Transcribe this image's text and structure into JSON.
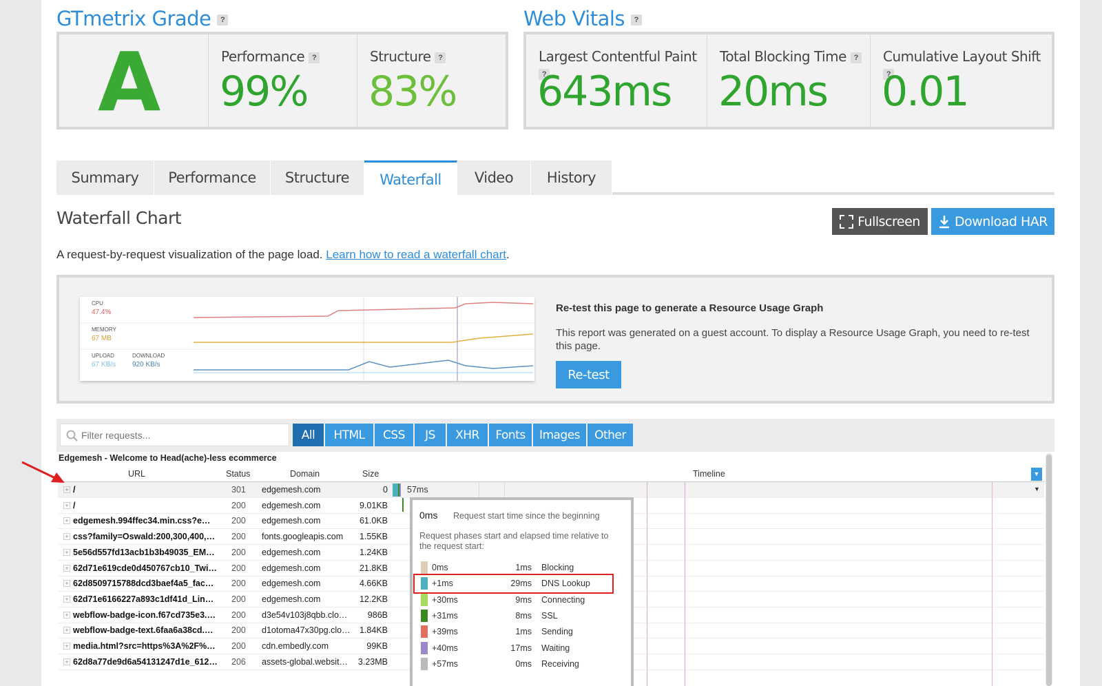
{
  "grade": {
    "title": "GTmetrix Grade",
    "help": "?",
    "letter": "A",
    "performance": {
      "label": "Performance",
      "value": "99%"
    },
    "structure": {
      "label": "Structure",
      "value": "83%"
    }
  },
  "vitals": {
    "title": "Web Vitals",
    "lcp": {
      "label": "Largest Contentful Paint",
      "value": "643ms"
    },
    "tbt": {
      "label": "Total Blocking Time",
      "value": "20ms"
    },
    "cls": {
      "label": "Cumulative Layout Shift",
      "value": "0.01"
    }
  },
  "tabs": [
    "Summary",
    "Performance",
    "Structure",
    "Waterfall",
    "Video",
    "History"
  ],
  "waterfall": {
    "title": "Waterfall Chart",
    "fullscreen": "Fullscreen",
    "download": "Download HAR",
    "desc": "A request-by-request visualization of the page load. ",
    "link": "Learn how to read a waterfall chart",
    "period": "."
  },
  "usage": {
    "cpu_label": "CPU",
    "cpu_val": "47.4%",
    "mem_label": "MEMORY",
    "mem_val": "67 MB",
    "up_label": "UPLOAD",
    "up_val": "67 KB/s",
    "down_label": "DOWNLOAD",
    "down_val": "920 KB/s",
    "heading": "Re-test this page to generate a Resource Usage Graph",
    "text": "This report was generated on a guest account. To display a Resource Usage Graph, you need to re-test this page.",
    "retest": "Re-test",
    "colors": {
      "cpu": "#e08080",
      "memory": "#e0b040",
      "upload": "#80c0e8",
      "download": "#5a90c0"
    }
  },
  "filter": {
    "placeholder": "Filter requests...",
    "tabs": [
      "All",
      "HTML",
      "CSS",
      "JS",
      "XHR",
      "Fonts",
      "Images",
      "Other"
    ]
  },
  "table": {
    "page_title": "Edgemesh - Welcome to Head(ache)-less ecommerce",
    "headers": {
      "url": "URL",
      "status": "Status",
      "domain": "Domain",
      "size": "Size",
      "timeline": "Timeline"
    },
    "rows": [
      {
        "url": "/",
        "status": "301",
        "domain": "edgemesh.com",
        "size": "0",
        "time": "57ms"
      },
      {
        "url": "/",
        "status": "200",
        "domain": "edgemesh.com",
        "size": "9.01KB"
      },
      {
        "url": "edgemesh.994ffec34.min.css?e…",
        "status": "200",
        "domain": "edgemesh.com",
        "size": "61.0KB"
      },
      {
        "url": "css?family=Oswald:200,300,400,…",
        "status": "200",
        "domain": "fonts.googleapis.com",
        "size": "1.55KB"
      },
      {
        "url": "5e56d557fd13acb1b3b49035_EM…",
        "status": "200",
        "domain": "edgemesh.com",
        "size": "1.24KB"
      },
      {
        "url": "62d71e619cde0d450767cb10_Twi…",
        "status": "200",
        "domain": "edgemesh.com",
        "size": "21.8KB"
      },
      {
        "url": "62d8509715788dcd3baef4a5_fac…",
        "status": "200",
        "domain": "edgemesh.com",
        "size": "4.66KB"
      },
      {
        "url": "62d71e6166227a893c1df41d_Lin…",
        "status": "200",
        "domain": "edgemesh.com",
        "size": "12.2KB"
      },
      {
        "url": "webflow-badge-icon.f67cd735e3.…",
        "status": "200",
        "domain": "d3e54v103j8qbb.clo…",
        "size": "986B"
      },
      {
        "url": "webflow-badge-text.6faa6a38cd.…",
        "status": "200",
        "domain": "d1otoma47x30pg.clo…",
        "size": "1.84KB"
      },
      {
        "url": "media.html?src=https%3A%2F%…",
        "status": "200",
        "domain": "cdn.embedly.com",
        "size": "99KB"
      },
      {
        "url": "62d8a77de9d6a54131247d1e_612…",
        "status": "206",
        "domain": "assets-global.websit…",
        "size": "3.23MB"
      }
    ]
  },
  "tooltip": {
    "start": "0ms",
    "start_desc": "Request start time since the beginning",
    "phases_desc": "Request phases start and elapsed time relative to the request start:",
    "phases": [
      {
        "start": "0ms",
        "dur": "1ms",
        "name": "Blocking",
        "color": "#e0d0b8"
      },
      {
        "start": "+1ms",
        "dur": "29ms",
        "name": "DNS Lookup",
        "color": "#4fb0c0"
      },
      {
        "start": "+30ms",
        "dur": "9ms",
        "name": "Connecting",
        "color": "#a8dc60"
      },
      {
        "start": "+31ms",
        "dur": "8ms",
        "name": "SSL",
        "color": "#3a8a20"
      },
      {
        "start": "+39ms",
        "dur": "1ms",
        "name": "Sending",
        "color": "#e07060"
      },
      {
        "start": "+40ms",
        "dur": "17ms",
        "name": "Waiting",
        "color": "#9a88c8"
      },
      {
        "start": "+57ms",
        "dur": "0ms",
        "name": "Receiving",
        "color": "#bbbbbb"
      }
    ]
  }
}
